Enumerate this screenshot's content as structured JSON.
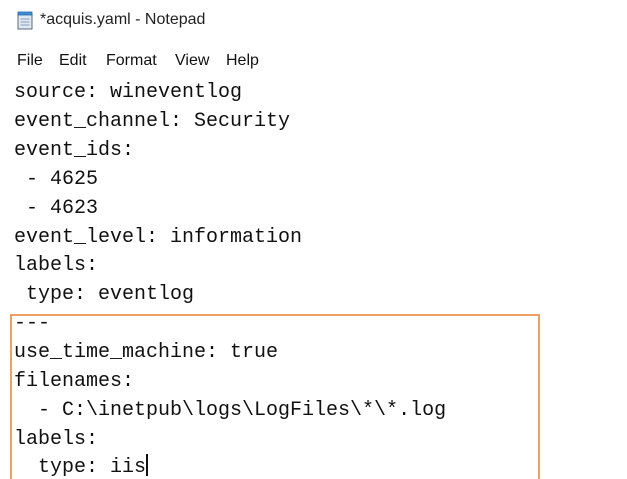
{
  "window": {
    "title": "*acquis.yaml - Notepad",
    "icon": "notepad-icon"
  },
  "menu": {
    "items": [
      "File",
      "Edit",
      "Format",
      "View",
      "Help"
    ]
  },
  "editor": {
    "lines": [
      "source: wineventlog",
      "event_channel: Security",
      "event_ids:",
      " - 4625",
      " - 4623",
      "event_level: information",
      "labels:",
      " type: eventlog",
      "---",
      "use_time_machine: true",
      "filenames:",
      "  - C:\\inetpub\\logs\\LogFiles\\*\\*.log",
      "labels:",
      "  type: iis"
    ]
  },
  "colors": {
    "highlight_border": "#f0a060",
    "text": "#111111"
  }
}
